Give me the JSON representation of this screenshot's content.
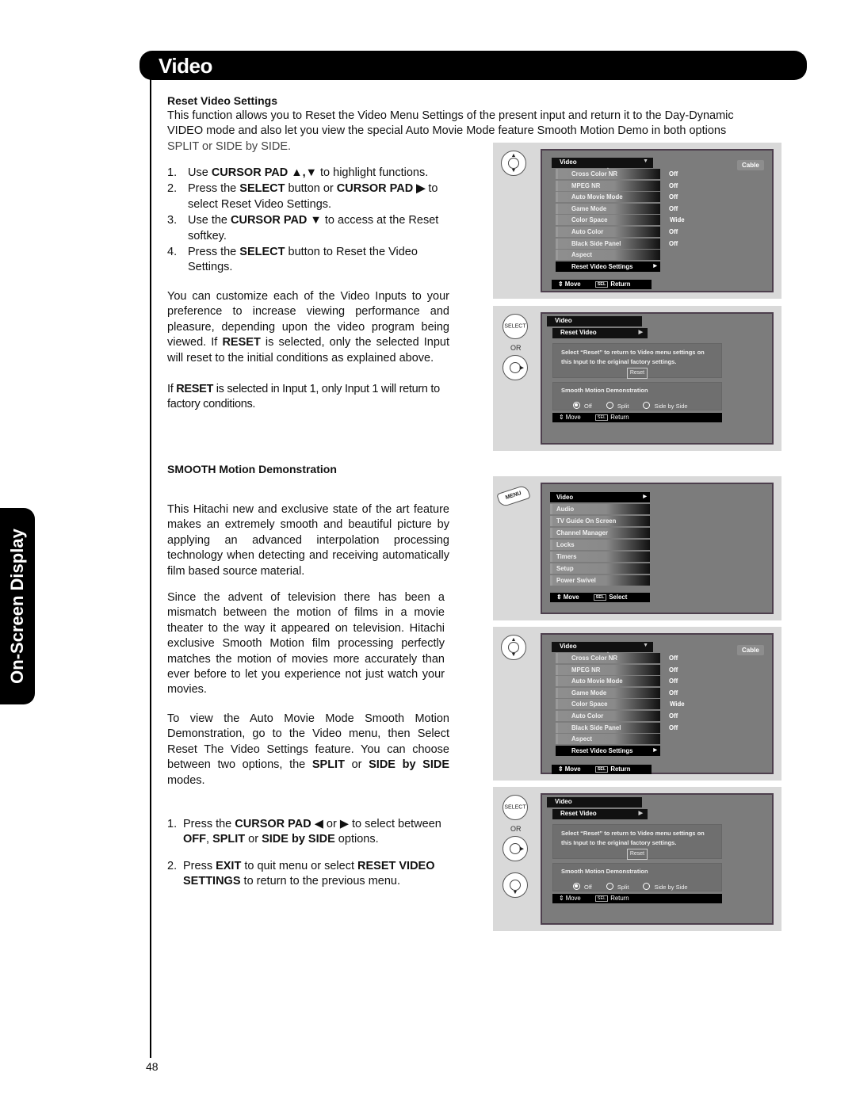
{
  "header": {
    "title": "Video"
  },
  "side_tab": {
    "label": "On-Screen Display"
  },
  "page_number": "48",
  "reset_section": {
    "heading": "Reset Video Settings",
    "intro": "This function allows you to Reset the Video Menu Settings of the present input and return it to the Day-Dynamic VIDEO mode and also let you view the special Auto Movie Mode feature Smooth Motion Demo in both options",
    "intro_tail": "SPLIT or SIDE by SIDE.",
    "steps": [
      {
        "num": "1.",
        "parts": [
          "Use ",
          "CURSOR PAD ▲,▼",
          " to highlight functions."
        ]
      },
      {
        "num": "2.",
        "parts": [
          "Press the ",
          "SELECT",
          " button or ",
          "CURSOR PAD ▶",
          " to select Reset Video Settings."
        ]
      },
      {
        "num": "3.",
        "parts": [
          "Use the ",
          "CURSOR PAD ▼",
          " to access at the Reset softkey."
        ]
      },
      {
        "num": "4.",
        "parts": [
          "Press the ",
          "SELECT",
          " button to Reset the Video Settings."
        ]
      }
    ],
    "para1": [
      "You can customize each of the Video Inputs to your preference to increase viewing performance and pleasure, depending upon the video program being viewed. If ",
      "RESET",
      " is selected, only the selected Input will reset to the initial conditions as explained above."
    ],
    "para2": [
      "If ",
      "RESET",
      " is selected in Input 1, only Input 1 will return to factory conditions."
    ]
  },
  "smooth_section": {
    "heading": "SMOOTH Motion Demonstration",
    "para1": "This Hitachi new and exclusive state of the art feature makes an extremely smooth and beautiful picture by applying an advanced interpolation processing technology when detecting and receiving automatically film based source material.",
    "para2": "Since the advent of television there has been a mismatch between the motion of films in a movie theater to the way it appeared on television. Hitachi exclusive Smooth Motion film processing perfectly matches the motion of movies more accurately than ever before to let you experience not just watch your movies.",
    "para3": [
      "To view the Auto Movie Mode Smooth Motion Demonstration, go to the Video menu, then Select Reset The Video Settings feature. You can choose between two options, the ",
      "SPLIT",
      " or ",
      "SIDE by SIDE",
      " modes."
    ],
    "steps": [
      {
        "num": "1.",
        "parts": [
          "Press the ",
          "CURSOR PAD",
          " ◀ or ▶ to select between ",
          "OFF",
          ", ",
          "SPLIT",
          " or ",
          "SIDE by SIDE",
          " options."
        ]
      },
      {
        "num": "2.",
        "parts": [
          "Press ",
          "EXIT",
          " to quit menu or select ",
          "RESET VIDEO SETTINGS",
          " to return to the previous menu."
        ]
      }
    ]
  },
  "video_menu": {
    "title": "Video",
    "source_badge": "Cable",
    "items": [
      {
        "label": "Cross Color NR",
        "value": "Off"
      },
      {
        "label": "MPEG NR",
        "value": "Off"
      },
      {
        "label": "Auto Movie Mode",
        "value": "Off"
      },
      {
        "label": "Game Mode",
        "value": "Off"
      },
      {
        "label": "Color Space",
        "value": "Wide"
      },
      {
        "label": "Auto Color",
        "value": "Off"
      },
      {
        "label": "Black Side Panel",
        "value": "Off"
      },
      {
        "label": "Aspect",
        "value": ""
      },
      {
        "label": "Reset Video Settings",
        "value": ""
      }
    ],
    "footer_move": "Move",
    "footer_key": "SEL",
    "footer_action": "Return"
  },
  "reset_menu": {
    "title": "Video",
    "submenu": "Reset Video",
    "message": "Select “Reset” to return to Video menu settings on this Input to the original factory settings.",
    "reset_button": "Reset",
    "demo_title": "Smooth Motion Demonstration",
    "options": [
      "Off",
      "Split",
      "Side by Side"
    ],
    "selected_option": "Off",
    "footer_move": "Move",
    "footer_key": "SEL",
    "footer_action": "Return"
  },
  "main_menu": {
    "items": [
      "Video",
      "Audio",
      "TV Guide On Screen",
      "Channel Manager",
      "Locks",
      "Timers",
      "Setup",
      "Power Swivel"
    ],
    "footer_move": "Move",
    "footer_key": "SEL",
    "footer_action": "Select"
  },
  "remote": {
    "select_label": "SELECT",
    "or_label": "OR",
    "menu_label": "MENU"
  }
}
